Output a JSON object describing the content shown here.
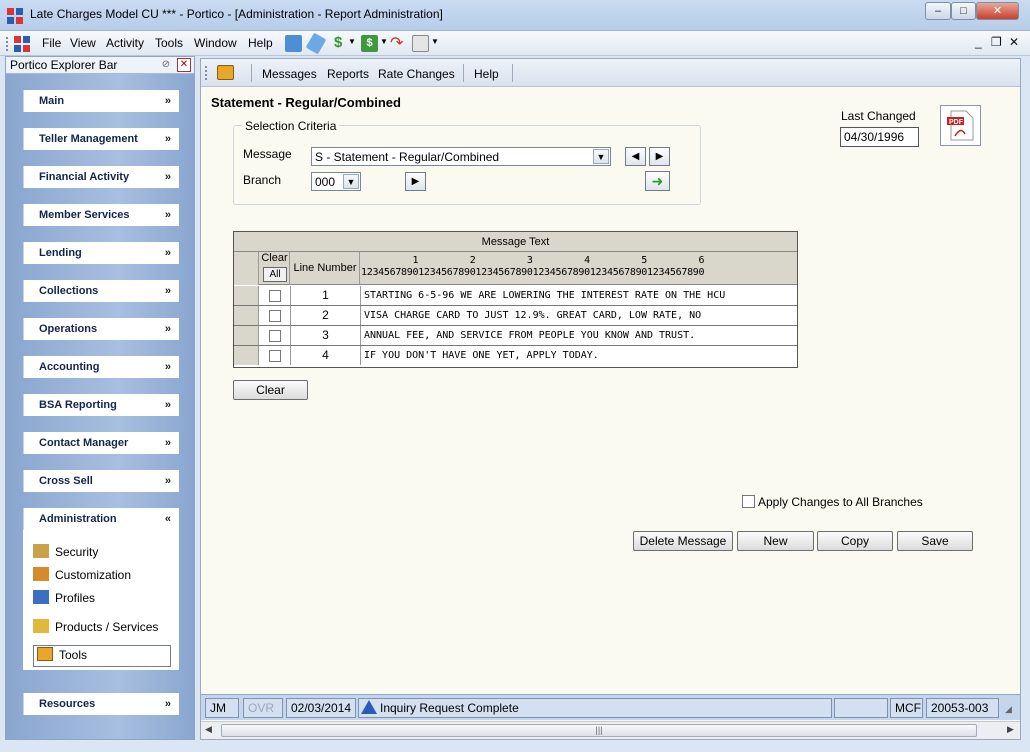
{
  "window": {
    "title": "Late Charges Model CU *** - Portico - [Administration - Report Administration]",
    "min_label": "–",
    "max_label": "□",
    "close_label": "✕"
  },
  "menubar": {
    "items": [
      "File",
      "View",
      "Activity",
      "Tools",
      "Window",
      "Help"
    ],
    "mdi_min": "_",
    "mdi_restore": "❐",
    "mdi_close": "✕"
  },
  "explorer": {
    "title": "Portico Explorer Bar",
    "close_label": "✕",
    "sections": [
      {
        "label": "Main"
      },
      {
        "label": "Teller Management"
      },
      {
        "label": "Financial Activity"
      },
      {
        "label": "Member Services"
      },
      {
        "label": "Lending"
      },
      {
        "label": "Collections"
      },
      {
        "label": "Operations"
      },
      {
        "label": "Accounting"
      },
      {
        "label": "BSA Reporting"
      },
      {
        "label": "Contact Manager"
      },
      {
        "label": "Cross Sell"
      }
    ],
    "expand_glyph": "»",
    "admin": {
      "label": "Administration",
      "collapse_glyph": "«",
      "items": [
        {
          "label": "Security",
          "icon": "security-icon"
        },
        {
          "label": "Customization",
          "icon": "customization-icon"
        },
        {
          "label": "Profiles",
          "icon": "profiles-icon"
        },
        {
          "label": "Products / Services",
          "icon": "products-services-icon"
        },
        {
          "label": "Tools",
          "icon": "tools-icon"
        }
      ]
    },
    "resources_label": "Resources"
  },
  "doc_toolbar": {
    "items": [
      "Messages",
      "Reports",
      "Rate Changes",
      "Help"
    ]
  },
  "page": {
    "title": "Statement - Regular/Combined",
    "last_changed_label": "Last Changed",
    "last_changed_value": "04/30/1996",
    "pdf_icon": "pdf-icon"
  },
  "criteria": {
    "legend": "Selection Criteria",
    "message_label": "Message",
    "message_value": "S - Statement - Regular/Combined",
    "branch_label": "Branch",
    "branch_value": "000"
  },
  "grid": {
    "header": "Message Text",
    "clear_header": "Clear",
    "clear_all_label": "All",
    "line_number_header": "Line Number",
    "ruler_top": "         1         2         3         4         5         6",
    "ruler_bottom": "123456789012345678901234567890123456789012345678901234567890",
    "rows": [
      {
        "line": "1",
        "text": "STARTING 6-5-96 WE ARE LOWERING THE INTEREST RATE ON THE HCU"
      },
      {
        "line": "2",
        "text": "VISA CHARGE CARD TO JUST 12.9%. GREAT CARD, LOW RATE, NO"
      },
      {
        "line": "3",
        "text": "ANNUAL FEE, AND SERVICE FROM PEOPLE YOU KNOW AND TRUST."
      },
      {
        "line": "4",
        "text": "IF YOU DON'T HAVE ONE YET, APPLY TODAY."
      }
    ]
  },
  "actions": {
    "clear": "Clear",
    "apply_all_label": "Apply Changes to All Branches",
    "delete": "Delete Message",
    "new": "New",
    "copy": "Copy",
    "save": "Save"
  },
  "status": {
    "user": "JM",
    "ovr": "OVR",
    "date": "02/03/2014",
    "message": "Inquiry Request Complete",
    "mode": "MCF",
    "code": "20053-003"
  },
  "colors": {
    "accent": "#8aa6cf",
    "doc_background": "#fbfaf1",
    "grid_header": "#d9d6cb"
  }
}
